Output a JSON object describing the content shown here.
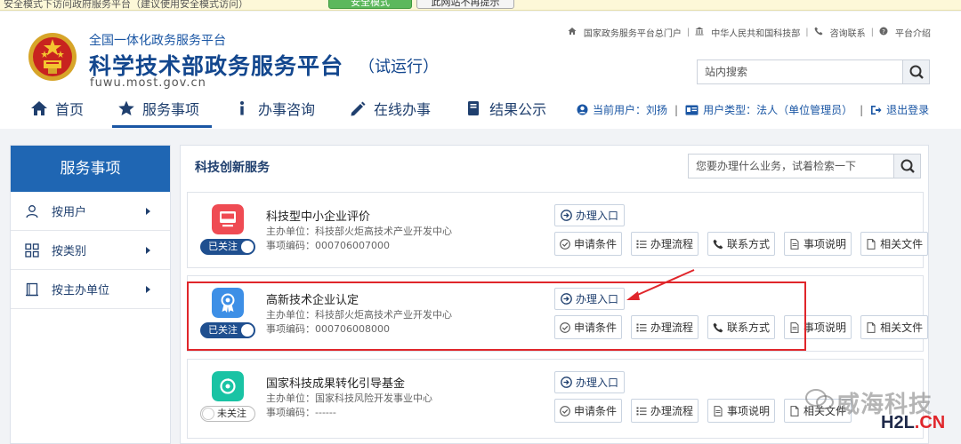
{
  "browser_notice": {
    "text": "安全模式下访问政府服务平台（建议使用安全模式访问）",
    "primary_button": "安全模式",
    "secondary_button": "此网站不再提示"
  },
  "header": {
    "subtitle": "全国一体化政务服务平台",
    "title": "科学技术部政务服务平台",
    "trial": "（试运行）",
    "url": "fuwu.most.gov.cn",
    "top_links": [
      "国家政务服务平台总门户",
      "中华人民共和国科技部",
      "咨询联系",
      "平台介绍"
    ],
    "search_placeholder": "站内搜索"
  },
  "nav": {
    "items": [
      {
        "label": "首页",
        "icon": "home-icon"
      },
      {
        "label": "服务事项",
        "icon": "star-icon",
        "active": true
      },
      {
        "label": "办事咨询",
        "icon": "info-icon"
      },
      {
        "label": "在线办事",
        "icon": "pencil-icon"
      },
      {
        "label": "结果公示",
        "icon": "book-icon"
      }
    ]
  },
  "user": {
    "current_user": "当前用户：刘扬",
    "user_type": "用户类型：法人（单位管理员）",
    "logout": "退出登录"
  },
  "sidebar": {
    "title": "服务事项",
    "items": [
      {
        "label": "按用户",
        "icon": "user-icon"
      },
      {
        "label": "按类别",
        "icon": "grid-icon"
      },
      {
        "label": "按主办单位",
        "icon": "building-icon"
      }
    ]
  },
  "main": {
    "section_title": "科技创新服务",
    "search_placeholder": "您要办理什么业务，试着检索一下",
    "enter_label": "办理入口",
    "services": [
      {
        "name": "科技型中小企业评价",
        "dept": "主办单位：科技部火炬高技术产业开发中心",
        "code": "事项编码：000706007000",
        "follow": "已关注",
        "followed": true,
        "color": "#ef4b53",
        "actions": [
          "申请条件",
          "办理流程",
          "联系方式",
          "事项说明",
          "相关文件"
        ]
      },
      {
        "name": "高新技术企业认定",
        "dept": "主办单位：科技部火炬高技术产业开发中心",
        "code": "事项编码：000706008000",
        "follow": "已关注",
        "followed": true,
        "color": "#3d8fe6",
        "actions": [
          "申请条件",
          "办理流程",
          "联系方式",
          "事项说明",
          "相关文件"
        ]
      },
      {
        "name": "国家科技成果转化引导基金",
        "dept": "主办单位：国家科技风险开发事业中心",
        "code": "事项编码：------",
        "follow": "未关注",
        "followed": false,
        "color": "#19c3a4",
        "actions": [
          "申请条件",
          "办理流程",
          "事项说明",
          "相关文件"
        ]
      }
    ]
  },
  "watermark": {
    "text": "威海科技",
    "site": "H2L",
    "site_suffix": ".CN"
  },
  "colors": {
    "primary": "#1a56a4",
    "sidebar_header": "#1f66b3",
    "highlight": "#e0262b"
  }
}
